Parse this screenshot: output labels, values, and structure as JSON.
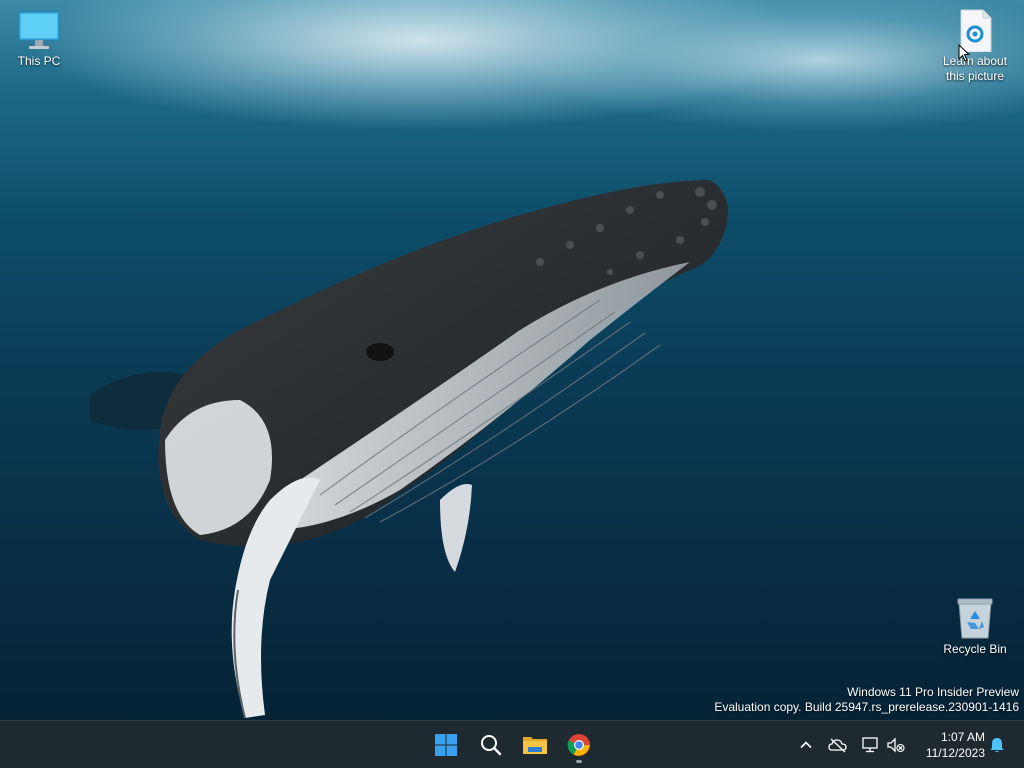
{
  "desktop": {
    "icons": {
      "this_pc": "This PC",
      "learn_line1": "Learn about",
      "learn_line2": "this picture",
      "recycle_bin": "Recycle Bin"
    },
    "watermark": {
      "line1": "Windows 11 Pro Insider Preview",
      "line2": "Evaluation copy. Build 25947.rs_prerelease.230901-1416"
    }
  },
  "taskbar": {
    "apps": [
      "start-icon",
      "search-icon",
      "file-explorer-icon",
      "chrome-icon"
    ],
    "tray": {
      "icons": [
        "chevron-up-icon",
        "onedrive-offline-icon",
        "network-icon",
        "volume-muted-icon",
        "notification-bell-icon"
      ],
      "time": "1:07 AM",
      "date": "11/12/2023"
    }
  },
  "colors": {
    "taskbar_bg": "#1f2a30",
    "start_blue": "#3aa0f0",
    "folder_yellow": "#f4c542",
    "notification_blue": "#4cc2ff"
  }
}
